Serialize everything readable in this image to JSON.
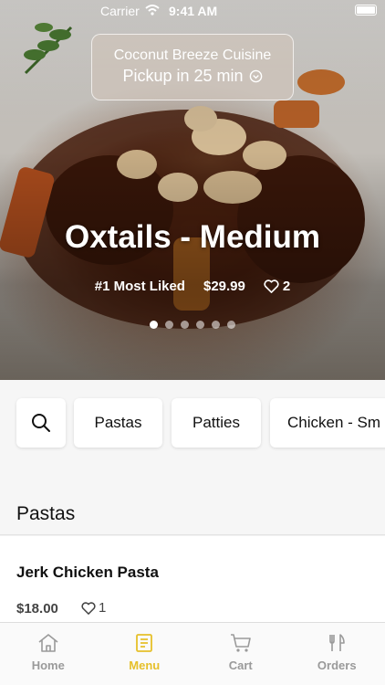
{
  "status_bar": {
    "carrier": "Carrier",
    "time": "9:41 AM"
  },
  "pickup": {
    "restaurant": "Coconut Breeze Cuisine",
    "pickup_text": "Pickup in 25 min"
  },
  "featured": {
    "title": "Oxtails - Medium",
    "rank": "#1 Most Liked",
    "price": "$29.99",
    "likes": "2",
    "slides": 6,
    "active_slide": 1
  },
  "categories": [
    "Pastas",
    "Patties",
    "Chicken - Sm"
  ],
  "section": {
    "title": "Pastas"
  },
  "items": [
    {
      "name": "Jerk Chicken Pasta",
      "price": "$18.00",
      "likes": "1"
    }
  ],
  "tabs": [
    {
      "label": "Home",
      "icon": "home-icon",
      "active": false
    },
    {
      "label": "Menu",
      "icon": "menu-book-icon",
      "active": true
    },
    {
      "label": "Cart",
      "icon": "cart-icon",
      "active": false
    },
    {
      "label": "Orders",
      "icon": "utensils-icon",
      "active": false
    }
  ],
  "colors": {
    "accent": "#e6c02a",
    "tab_inactive": "#9a9a9a"
  }
}
